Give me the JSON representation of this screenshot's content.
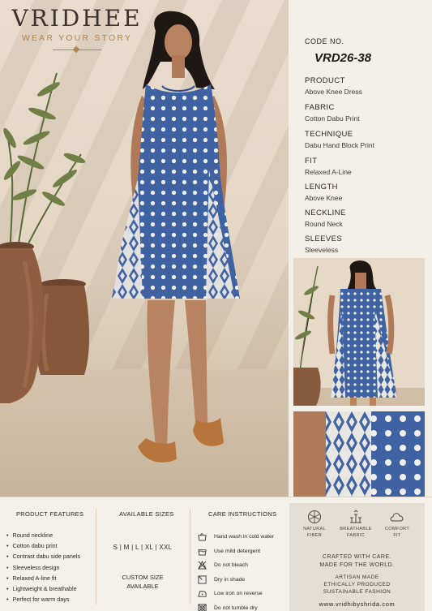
{
  "brand": {
    "name": "VRIDHEE",
    "tagline": "WEAR YOUR STORY"
  },
  "product": {
    "code_label": "CODE NO.",
    "code": "VRD26-38",
    "specs": [
      {
        "label": "PRODUCT",
        "value": "Above Knee Dress"
      },
      {
        "label": "FABRIC",
        "value": "Cotton Dabu Print"
      },
      {
        "label": "TECHNIQUE",
        "value": "Dabu Hand Block Print"
      },
      {
        "label": "FIT",
        "value": "Relaxed A-Line"
      },
      {
        "label": "LENGTH",
        "value": "Above Knee"
      },
      {
        "label": "NECKLINE",
        "value": "Round Neck"
      },
      {
        "label": "SLEEVES",
        "value": "Sleeveless"
      }
    ]
  },
  "features": {
    "heading": "PRODUCT FEATURES",
    "items": [
      "Round neckline",
      "Cotton dabu print",
      "Contrast dabu side panels",
      "Sleeveless design",
      "Relaxed A-line fit",
      "Lightweight & breathable",
      "Perfect for warm days"
    ]
  },
  "sizes": {
    "heading": "AVAILABLE SIZES",
    "list": "S  |  M  |  L  |  XL  |  XXL",
    "custom_line1": "CUSTOM SIZE",
    "custom_line2": "AVAILABLE"
  },
  "care": {
    "heading": "CARE INSTRUCTIONS",
    "items": [
      {
        "icon": "hand-wash-icon",
        "text": "Hand wash in cold water"
      },
      {
        "icon": "detergent-icon",
        "text": "Use mild detergent"
      },
      {
        "icon": "no-bleach-icon",
        "text": "Do not bleach"
      },
      {
        "icon": "dry-shade-icon",
        "text": "Dry in shade"
      },
      {
        "icon": "low-iron-icon",
        "text": "Low iron on reverse"
      },
      {
        "icon": "no-tumble-dry-icon",
        "text": "Do not tumble dry"
      }
    ]
  },
  "badges": [
    {
      "icon": "natural-fiber-icon",
      "line1": "NATURAL",
      "line2": "FIBER"
    },
    {
      "icon": "breathable-icon",
      "line1": "BREATHABLE",
      "line2": "FABRIC"
    },
    {
      "icon": "cloud-icon",
      "line1": "COMFORT",
      "line2": "FIT"
    }
  ],
  "brand_box": {
    "craft_line1": "CRAFTED WITH CARE.",
    "craft_line2": "MADE FOR THE WORLD.",
    "artisan_line1": "ARTISAN MADE",
    "artisan_line2": "ETHICALLY PRODUCED",
    "artisan_line3": "SUSTAINABLE FASHION",
    "website": "www.vridhibyshrida.com"
  },
  "colors": {
    "accent": "#b08552",
    "indigo": "#3f62a3",
    "terracotta": "#8a5a3c",
    "background": "#f3efe9"
  }
}
